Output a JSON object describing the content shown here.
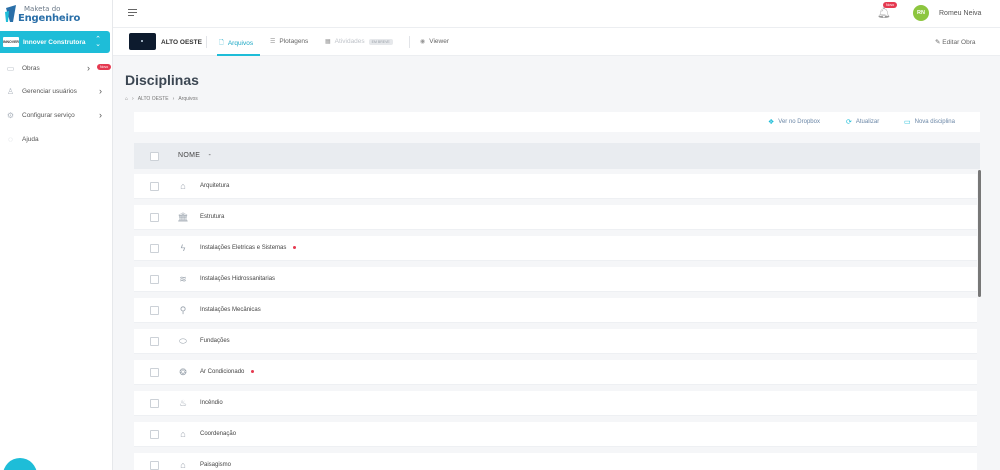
{
  "logo": {
    "line1": "Maketa do",
    "line2": "Engenheiro"
  },
  "sidebar": {
    "company": {
      "badge": "INNOVER",
      "name": "Innover Construtora"
    },
    "items": [
      {
        "label": "Obras",
        "icon": "building-icon",
        "badge": "Novo"
      },
      {
        "label": "Gerenciar usuários",
        "icon": "user-icon"
      },
      {
        "label": "Configurar serviço",
        "icon": "gear-icon"
      },
      {
        "label": "Ajuda",
        "icon": "help-icon"
      }
    ]
  },
  "header": {
    "notification_badge": "Novo",
    "user": {
      "initials": "RN",
      "name": "Romeu Neiva"
    }
  },
  "project_bar": {
    "project_name": "ALTO OESTE",
    "tabs": [
      {
        "label": "Arquivos",
        "icon": "file-icon",
        "state": "active"
      },
      {
        "label": "Plotagens",
        "icon": "stack-icon",
        "state": "normal"
      },
      {
        "label": "Atividades",
        "icon": "calendar-icon",
        "state": "disabled",
        "tag": "EM BREVE"
      },
      {
        "label": "Viewer",
        "icon": "eye-icon",
        "state": "normal"
      }
    ],
    "edit_label": "Editar Obra"
  },
  "main": {
    "title": "Disciplinas",
    "breadcrumb": [
      "ALTO OESTE",
      "Arquivos"
    ],
    "actions": [
      {
        "label": "Ver no Dropbox",
        "icon": "dropbox-icon"
      },
      {
        "label": "Atualizar",
        "icon": "refresh-icon"
      },
      {
        "label": "Nova disciplina",
        "icon": "folder-plus-icon"
      }
    ],
    "table": {
      "column_name": "NOME",
      "sort_indicator": "-",
      "rows": [
        {
          "label": "Arquitetura",
          "icon": "house-icon",
          "dot": false
        },
        {
          "label": "Estrutura",
          "icon": "columns-icon",
          "dot": false
        },
        {
          "label": "Instalações Eletricas e Sistemas",
          "icon": "lightning-icon",
          "dot": true
        },
        {
          "label": "Instalações Hidrossanitarias",
          "icon": "water-icon",
          "dot": false
        },
        {
          "label": "Instalações Mecânicas",
          "icon": "wrench-icon",
          "dot": false
        },
        {
          "label": "Fundações",
          "icon": "foundation-icon",
          "dot": false
        },
        {
          "label": "Ar Condicionado",
          "icon": "fan-icon",
          "dot": true
        },
        {
          "label": "Incêndio",
          "icon": "fire-icon",
          "dot": false
        },
        {
          "label": "Coordenação",
          "icon": "house-icon",
          "dot": false
        },
        {
          "label": "Paisagismo",
          "icon": "house-icon",
          "dot": false
        }
      ]
    }
  },
  "colors": {
    "accent": "#1ebdd8",
    "badge": "#e53950",
    "avatar": "#8dc63f"
  }
}
